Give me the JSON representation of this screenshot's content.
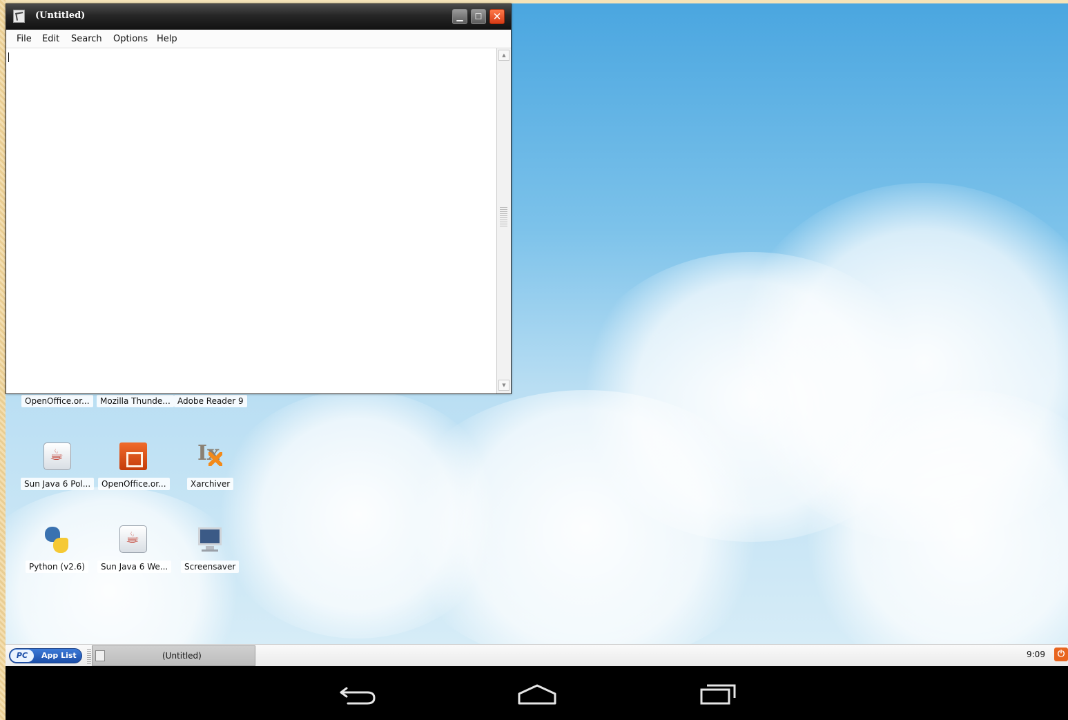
{
  "window": {
    "title": "(Untitled)",
    "close_glyph": "✕",
    "minimize_glyph": "▁",
    "maximize_glyph": "☐",
    "menu": [
      {
        "label": "File"
      },
      {
        "label": "Edit"
      },
      {
        "label": "Search"
      },
      {
        "label": "Options"
      },
      {
        "label": "Help"
      }
    ],
    "scroll_up_glyph": "▲",
    "scroll_down_glyph": "▼"
  },
  "desktop": {
    "icons_row1": [
      {
        "label": "OpenOffice.or..."
      },
      {
        "label": "Mozilla Thunde..."
      },
      {
        "label": "Adobe Reader 9"
      }
    ],
    "icons_row2": [
      {
        "label": "Sun Java 6 Pol...",
        "icon": "java-icon"
      },
      {
        "label": "OpenOffice.or...",
        "icon": "openoffice-icon"
      },
      {
        "label": "Xarchiver",
        "icon": "xarchiver-icon"
      }
    ],
    "icons_row3": [
      {
        "label": "Python (v2.6)",
        "icon": "python-icon"
      },
      {
        "label": "Sun Java 6 We...",
        "icon": "java-icon"
      },
      {
        "label": "Screensaver",
        "icon": "screensaver-icon"
      }
    ]
  },
  "taskbar": {
    "applist_logo": "PC",
    "applist_label": "App List",
    "task_label": "(Untitled)",
    "clock": "9:09",
    "power_glyph": "⏻"
  },
  "colors": {
    "sky": "#7cc2ea",
    "close_button": "#d73b16",
    "applist_blue": "#1c4ea8",
    "power_orange": "#e8651f"
  }
}
